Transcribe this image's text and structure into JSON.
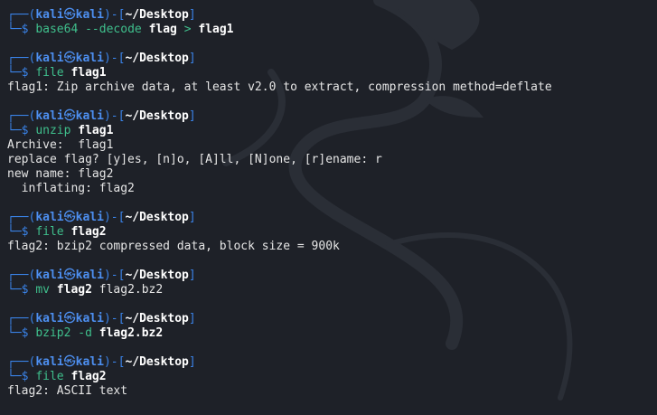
{
  "terminal": {
    "prompt": {
      "corner_top": "┌──(",
      "user": "kali",
      "skull": "㉿",
      "host": "kali",
      "mid": ")-[",
      "path": "~/Desktop",
      "close": "]",
      "corner_bottom": "└─",
      "dollar": "$"
    },
    "blocks": [
      {
        "command": "base64",
        "parts": [
          {
            "text": " --decode ",
            "style": "opt"
          },
          {
            "text": "flag",
            "style": "arg"
          },
          {
            "text": " > ",
            "style": "opt"
          },
          {
            "text": "flag1",
            "style": "arg"
          }
        ],
        "output": []
      },
      {
        "command": "file",
        "parts": [
          {
            "text": " ",
            "style": "argn"
          },
          {
            "text": "flag1",
            "style": "arg"
          }
        ],
        "output": [
          "flag1: Zip archive data, at least v2.0 to extract, compression method=deflate"
        ]
      },
      {
        "command": "unzip",
        "parts": [
          {
            "text": " ",
            "style": "argn"
          },
          {
            "text": "flag1",
            "style": "arg"
          }
        ],
        "output": [
          "Archive:  flag1",
          "replace flag? [y]es, [n]o, [A]ll, [N]one, [r]ename: r",
          "new name: flag2",
          "  inflating: flag2"
        ]
      },
      {
        "command": "file",
        "parts": [
          {
            "text": " ",
            "style": "argn"
          },
          {
            "text": "flag2",
            "style": "arg"
          }
        ],
        "output": [
          "flag2: bzip2 compressed data, block size = 900k"
        ]
      },
      {
        "command": "mv",
        "parts": [
          {
            "text": " ",
            "style": "argn"
          },
          {
            "text": "flag2",
            "style": "arg"
          },
          {
            "text": " flag2.bz2",
            "style": "argn"
          }
        ],
        "output": []
      },
      {
        "command": "bzip2",
        "parts": [
          {
            "text": " -d ",
            "style": "opt"
          },
          {
            "text": "flag2.bz2",
            "style": "arg"
          }
        ],
        "output": []
      },
      {
        "command": "file",
        "parts": [
          {
            "text": " ",
            "style": "argn"
          },
          {
            "text": "flag2",
            "style": "arg"
          }
        ],
        "output": [
          "flag2: ASCII text"
        ]
      }
    ]
  },
  "colors": {
    "background": "#1e2128",
    "prompt_blue": "#3a83e8",
    "command_green": "#3fbf8c",
    "text": "#e6e6e6"
  }
}
